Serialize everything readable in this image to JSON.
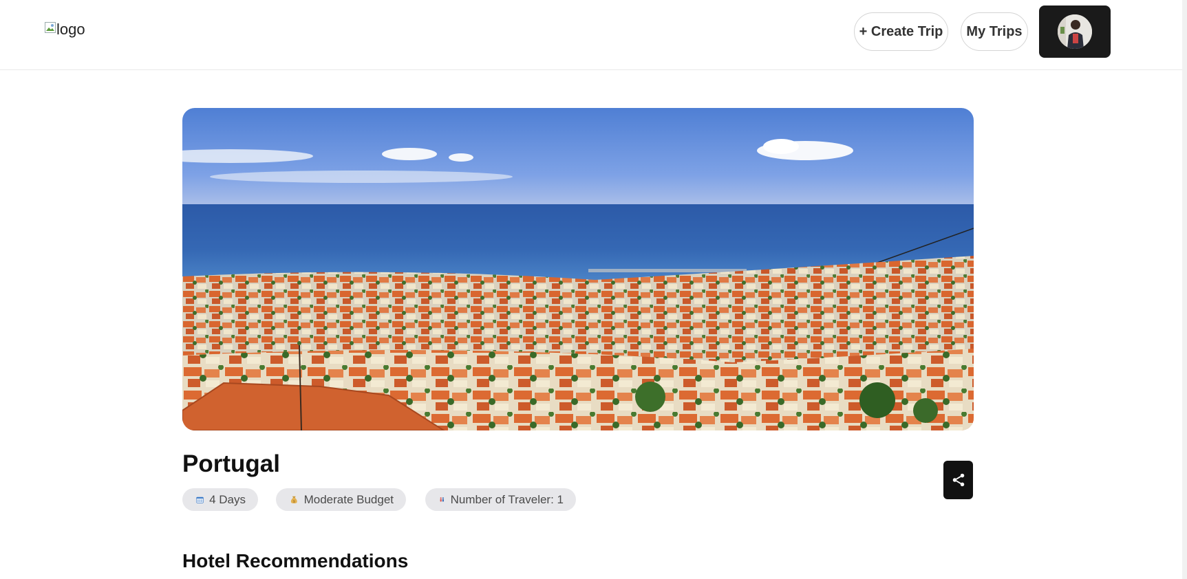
{
  "header": {
    "logo_alt": "logo",
    "create_trip_label": "+ Create Trip",
    "my_trips_label": "My Trips"
  },
  "hero": {
    "image_alt": "Portugal"
  },
  "trip": {
    "destination": "Portugal",
    "days_label": "4 Days",
    "budget_label": "Moderate Budget",
    "travelers_label": "Number of Traveler: 1"
  },
  "sections": {
    "hotels_title": "Hotel Recommendations"
  },
  "icons": {
    "days": "calendar-icon",
    "budget": "money-bag-icon",
    "travelers": "travelers-icon",
    "share": "share-icon"
  },
  "colors": {
    "primary_dark": "#111111",
    "chip_bg": "#e7e7ea",
    "header_border": "#e8e8e8"
  }
}
